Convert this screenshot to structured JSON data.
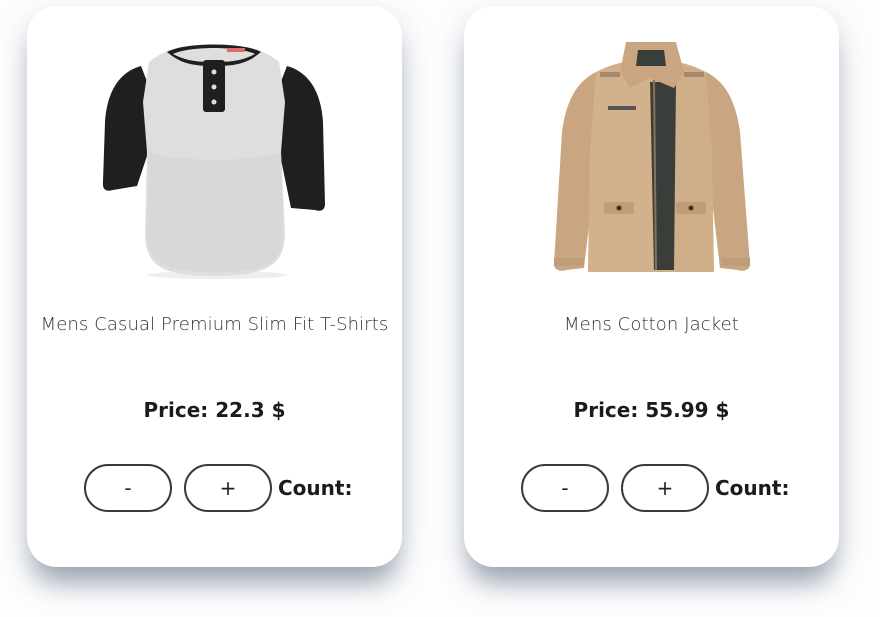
{
  "products": [
    {
      "name": "Mens Casual Premium Slim Fit T-Shirts",
      "price": "Price: 22.3 $",
      "decrement_label": "-",
      "increment_label": "+",
      "count_label": "Count:",
      "image": "tshirt-image"
    },
    {
      "name": "Mens Cotton Jacket",
      "price": "Price: 55.99 $",
      "decrement_label": "-",
      "increment_label": "+",
      "count_label": "Count:",
      "image": "jacket-image"
    }
  ],
  "colors": {
    "card_background": "#ffffff",
    "button_border": "#3a3a3a",
    "text_dark": "#1b1b1b",
    "jacket_tan": "#cfae8a",
    "shirt_gray": "#dedede",
    "sleeve_black": "#1f1f1f"
  }
}
